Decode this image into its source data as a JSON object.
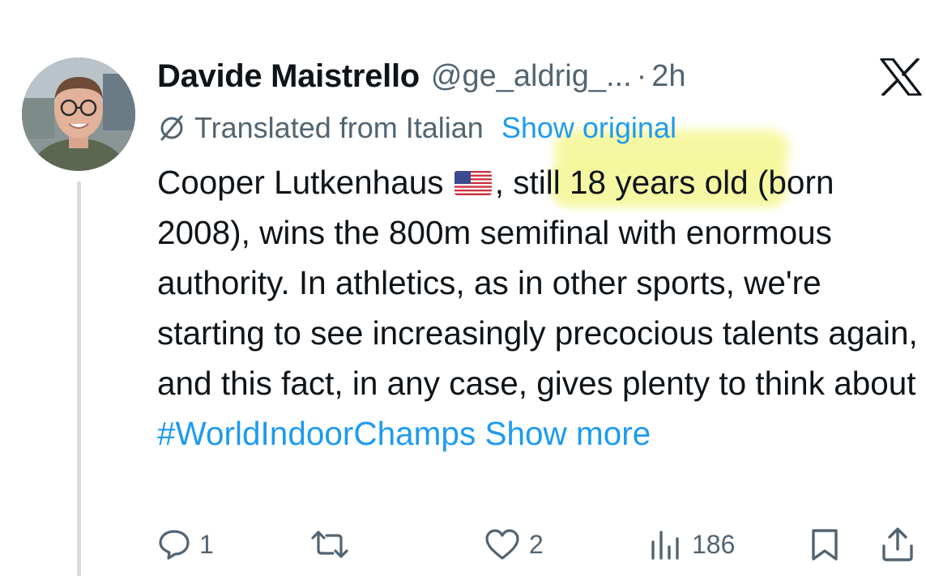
{
  "author": {
    "display_name": "Davide Maistrello",
    "handle": "@ge_aldrig_...",
    "dot": "·",
    "time": "2h"
  },
  "translation": {
    "label": "Translated from Italian",
    "show_original": "Show original"
  },
  "body": {
    "line_1_start": "Cooper Lutkenhaus",
    "line_1_highlight": ", still 18 years",
    "line_1_end": " old (born 2008), wins the 800m semifinal with enormous authority. In athletics, as in other sports, we're starting to see increasingly precocious talents again, and this fact, in any case, gives plenty to think about",
    "hashtag": "#WorldIndoorChamps",
    "show_more": "Show more"
  },
  "actions": {
    "reply_count": "1",
    "like_count": "2",
    "views_count": "186"
  },
  "icons": {
    "logo": "x-logo-icon",
    "translate": "translate-icon",
    "flag": "us-flag-icon",
    "reply": "reply-icon",
    "repost": "repost-icon",
    "like": "heart-icon",
    "views": "views-icon",
    "bookmark": "bookmark-icon",
    "share": "share-icon"
  },
  "colors": {
    "link": "#1d9bf0",
    "secondary_text": "#536471",
    "highlight": "#f5f79a"
  }
}
